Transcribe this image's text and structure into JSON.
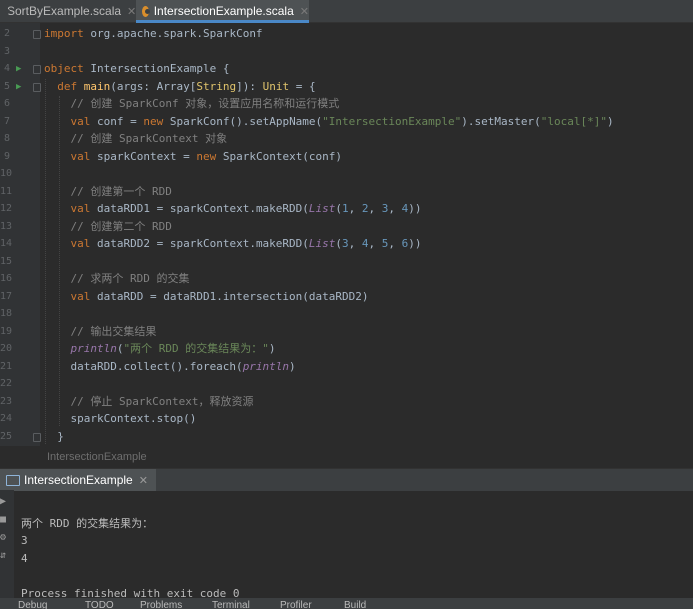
{
  "tabs": [
    {
      "label": "SortByExample.scala",
      "active": false
    },
    {
      "label": "IntersectionExample.scala",
      "active": true
    }
  ],
  "editor": {
    "breadcrumb": "IntersectionExample",
    "line_numbers": [
      "2",
      "3",
      "4",
      "5",
      "6",
      "7",
      "8",
      "9",
      "10",
      "11",
      "12",
      "13",
      "14",
      "15",
      "16",
      "17",
      "18",
      "19",
      "20",
      "21",
      "22",
      "23",
      "24",
      "25"
    ],
    "comments": {
      "c6": "// 创建 SparkConf 对象，设置应用名称和运行模式",
      "c8": "// 创建 SparkContext 对象",
      "c11": "// 创建第一个 RDD",
      "c13": "// 创建第二个 RDD",
      "c16": "// 求两个 RDD 的交集",
      "c19": "// 输出交集结果",
      "c23": "// 停止 SparkContext，释放资源"
    },
    "strings": {
      "appname": "\"IntersectionExample\"",
      "master": "\"local[*]\"",
      "result": "\"两个 RDD 的交集结果为：\""
    }
  },
  "run_panel": {
    "tab_label": "IntersectionExample",
    "output": [
      "两个 RDD 的交集结果为：",
      "3",
      "4",
      "",
      "Process finished with exit code 0"
    ]
  },
  "bottom_bar": [
    "Debug",
    "TODO",
    "Problems",
    "Terminal",
    "Profiler",
    "Build"
  ]
}
